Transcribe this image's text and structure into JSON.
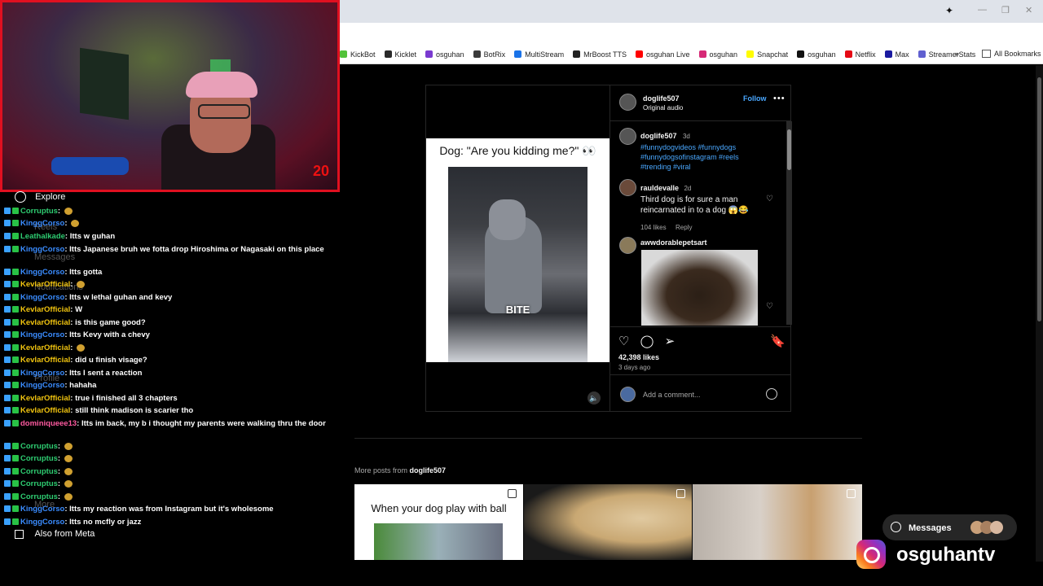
{
  "bookmarks": [
    "KickBot",
    "Kicklet",
    "osguhan",
    "BotRix",
    "MultiStream",
    "MrBoost TTS",
    "osguhan Live",
    "osguhan",
    "Snapchat",
    "osguhan",
    "Netflix",
    "Max",
    "StreamerStats"
  ],
  "bookmark_colors": [
    "#52c23a",
    "#2a2a2a",
    "#7a3ad0",
    "#3a3a3a",
    "#1a73e8",
    "#222",
    "#ff0000",
    "#d62976",
    "#fffc00",
    "#111",
    "#e50914",
    "#1a1aa0",
    "#6060d0"
  ],
  "all_bookmarks": "All Bookmarks",
  "webcam": {
    "badge": "20"
  },
  "sidebar_nav": {
    "explore": "Explore",
    "also_from_meta": "Also from Meta",
    "reels": "Reels",
    "messages": "Messages",
    "notifications": "Notifications",
    "profile": "Profile",
    "more": "More"
  },
  "chat": [
    {
      "user": "Corruptus",
      "user_color": "#2ecc71",
      "text": "",
      "emote": true
    },
    {
      "user": "KinggCorso",
      "user_color": "#3a8cff",
      "text": "",
      "emote": true
    },
    {
      "user": "Leathalkade",
      "user_color": "#2ecc71",
      "text": "Itts w guhan"
    },
    {
      "user": "KinggCorso",
      "user_color": "#3a8cff",
      "text": "Itts Japanese bruh we fotta drop Hiroshima or Nagasaki on this place"
    },
    {
      "user": "KinggCorso",
      "user_color": "#3a8cff",
      "text": "Itts gotta"
    },
    {
      "user": "KevlarOfficial",
      "user_color": "#f1c40f",
      "text": "",
      "emote": true
    },
    {
      "user": "KinggCorso",
      "user_color": "#3a8cff",
      "text": "Itts w lethal guhan and kevy"
    },
    {
      "user": "KevlarOfficial",
      "user_color": "#f1c40f",
      "text": "W"
    },
    {
      "user": "KevlarOfficial",
      "user_color": "#f1c40f",
      "text": "is this game good?"
    },
    {
      "user": "KinggCorso",
      "user_color": "#3a8cff",
      "text": "Itts Kevy with a chevy"
    },
    {
      "user": "KevlarOfficial",
      "user_color": "#f1c40f",
      "text": "",
      "emote": true
    },
    {
      "user": "KevlarOfficial",
      "user_color": "#f1c40f",
      "text": "did u finish visage?"
    },
    {
      "user": "KinggCorso",
      "user_color": "#3a8cff",
      "text": "Itts I sent a reaction"
    },
    {
      "user": "KinggCorso",
      "user_color": "#3a8cff",
      "text": "hahaha"
    },
    {
      "user": "KevlarOfficial",
      "user_color": "#f1c40f",
      "text": "true i finished all 3 chapters"
    },
    {
      "user": "KevlarOfficial",
      "user_color": "#f1c40f",
      "text": "still think madison is scarier tho"
    },
    {
      "user": "dominiqueee13",
      "user_color": "#ff5aa0",
      "text": "Itts im back, my b i thought my parents were walking thru the door"
    },
    {
      "user": "Corruptus",
      "user_color": "#2ecc71",
      "text": "",
      "emote": true
    },
    {
      "user": "Corruptus",
      "user_color": "#2ecc71",
      "text": "",
      "emote": true
    },
    {
      "user": "Corruptus",
      "user_color": "#2ecc71",
      "text": "",
      "emote": true
    },
    {
      "user": "Corruptus",
      "user_color": "#2ecc71",
      "text": "",
      "emote": true
    },
    {
      "user": "Corruptus",
      "user_color": "#2ecc71",
      "text": "",
      "emote": true
    },
    {
      "user": "KinggCorso",
      "user_color": "#3a8cff",
      "text": "Itts my reaction was from Instagram but it's wholesome"
    },
    {
      "user": "KinggCorso",
      "user_color": "#3a8cff",
      "text": "Itts no mcfly or jazz"
    }
  ],
  "post": {
    "author": "doglife507",
    "audio": "Original audio",
    "follow": "Follow",
    "reel_caption": "Dog: \"Are you kidding me?\" 👀",
    "video_text": "BITE",
    "caption_author": "doglife507",
    "caption_time": "3d",
    "caption_tags": "#funnydogvideos #funnydogs #funnydogsofinstagram #reels #trending #viral",
    "comments": [
      {
        "user": "rauldevalle",
        "time": "2d",
        "text": "Third dog is for sure a man reincarnated in to a dog 😱😂",
        "likes": "104 likes",
        "reply": "Reply"
      },
      {
        "user": "awwdorablepetsart",
        "time": "",
        "text": ""
      }
    ],
    "likes": "42,398 likes",
    "posted": "3 days ago",
    "add_comment_placeholder": "Add a comment..."
  },
  "more_posts": {
    "label": "More posts from",
    "author": "doglife507",
    "thumb1_caption": "When your dog play with ball"
  },
  "messages_label": "Messages",
  "overlay_name": "osguhantv"
}
